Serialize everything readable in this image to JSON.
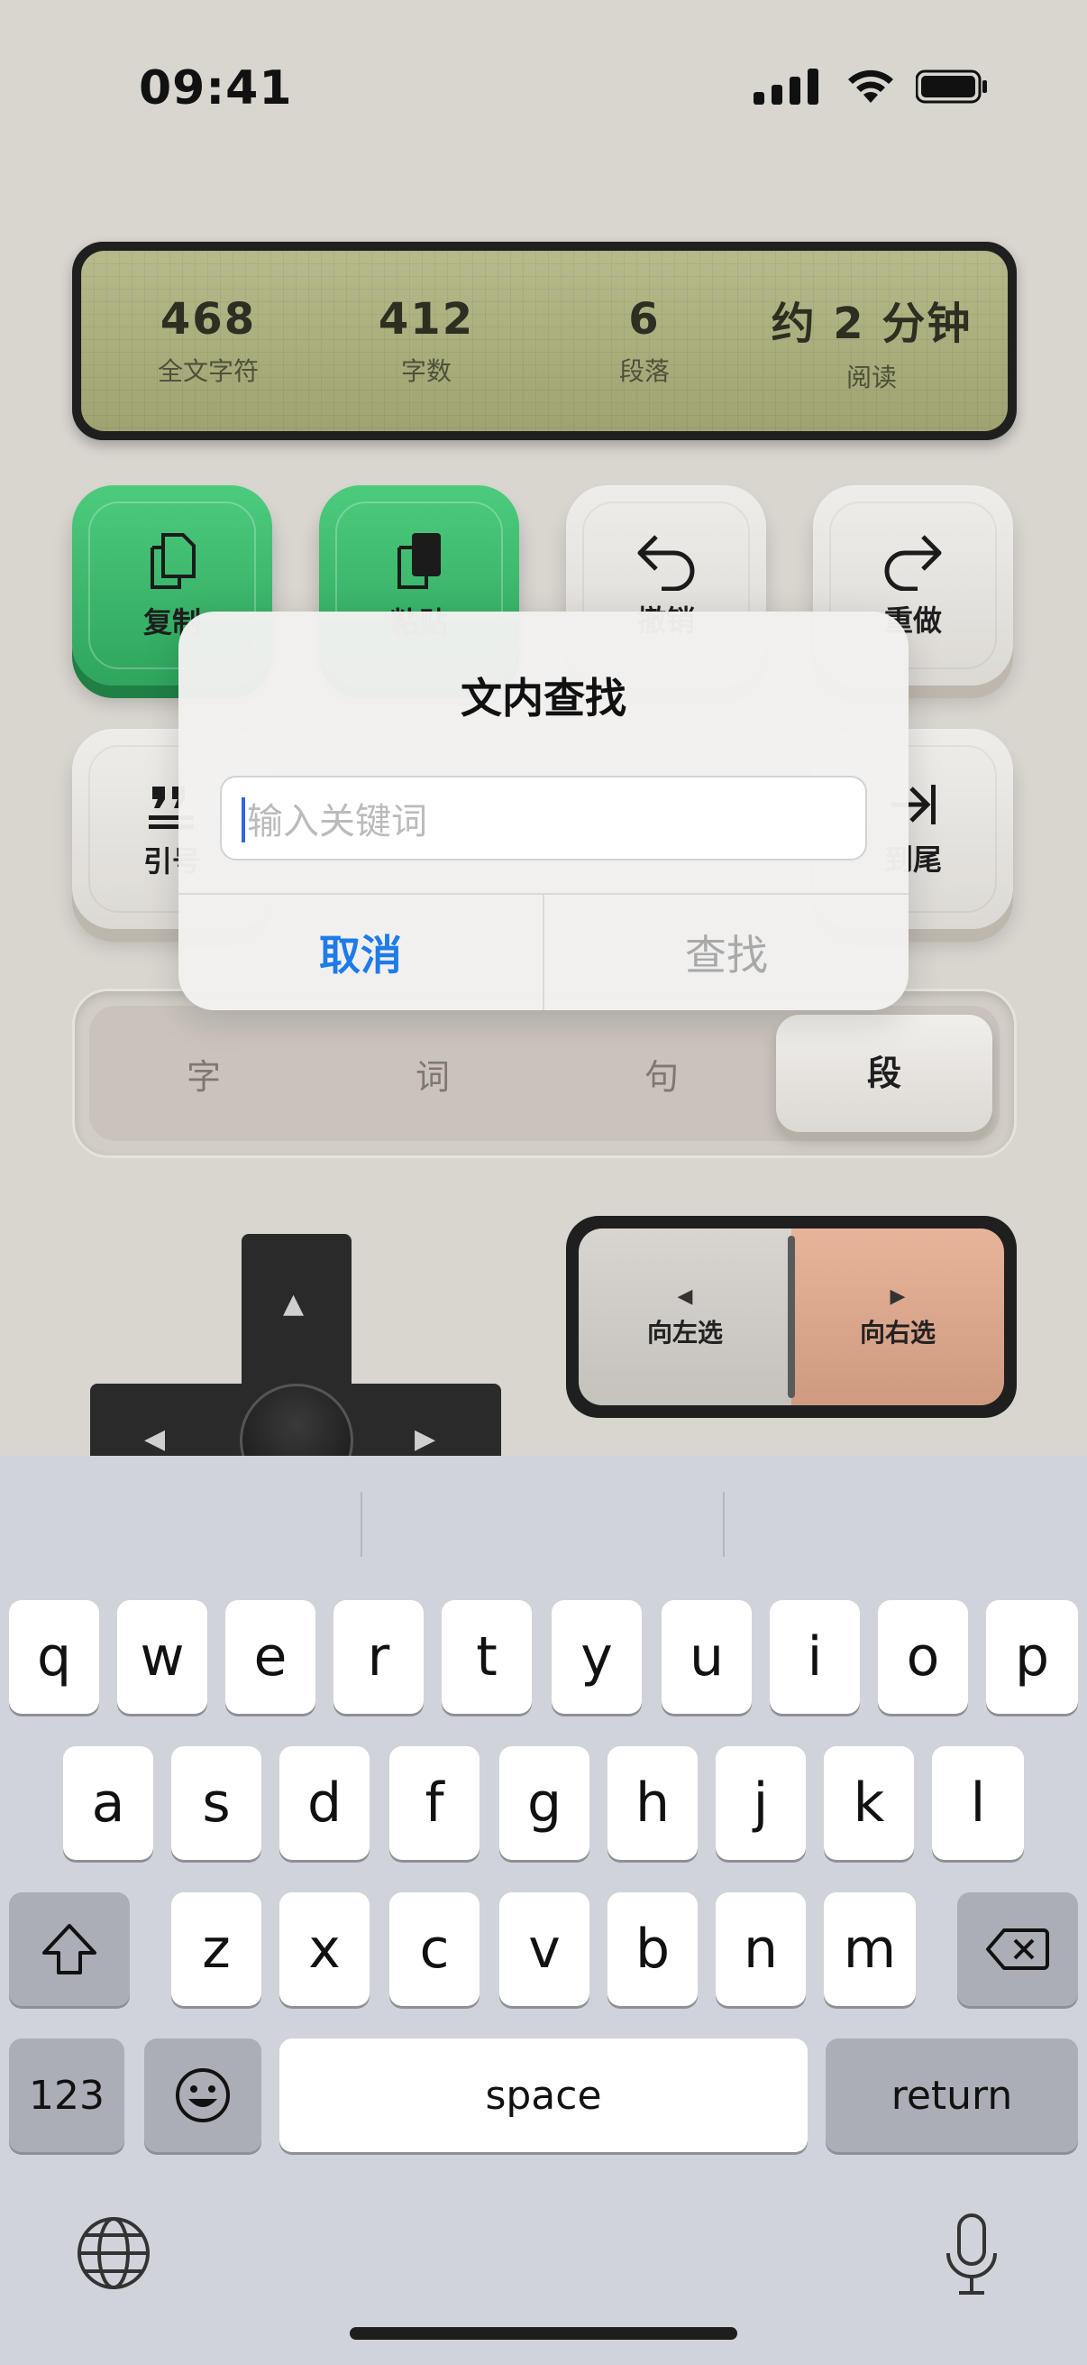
{
  "status_bar": {
    "time": "09:41"
  },
  "stats": [
    {
      "value": "468",
      "label": "全文字符"
    },
    {
      "value": "412",
      "label": "字数"
    },
    {
      "value": "6",
      "label": "段落"
    },
    {
      "value": "约 2 分钟",
      "label": "阅读"
    }
  ],
  "actions": {
    "copy": "复制",
    "paste": "粘贴",
    "undo": "撤销",
    "redo": "重做",
    "quote": "引号",
    "end": "到尾"
  },
  "granularity": {
    "items": [
      "字",
      "词",
      "句",
      "段"
    ],
    "selected": "段"
  },
  "select_toggle": {
    "left": "向左选",
    "right": "向右选"
  },
  "dialog": {
    "title": "文内查找",
    "placeholder": "输入关键词",
    "cancel": "取消",
    "find": "查找"
  },
  "keyboard": {
    "row1": [
      "q",
      "w",
      "e",
      "r",
      "t",
      "y",
      "u",
      "i",
      "o",
      "p"
    ],
    "row2": [
      "a",
      "s",
      "d",
      "f",
      "g",
      "h",
      "j",
      "k",
      "l"
    ],
    "row3": [
      "z",
      "x",
      "c",
      "v",
      "b",
      "n",
      "m"
    ],
    "numbers": "123",
    "space": "space",
    "return": "return"
  }
}
